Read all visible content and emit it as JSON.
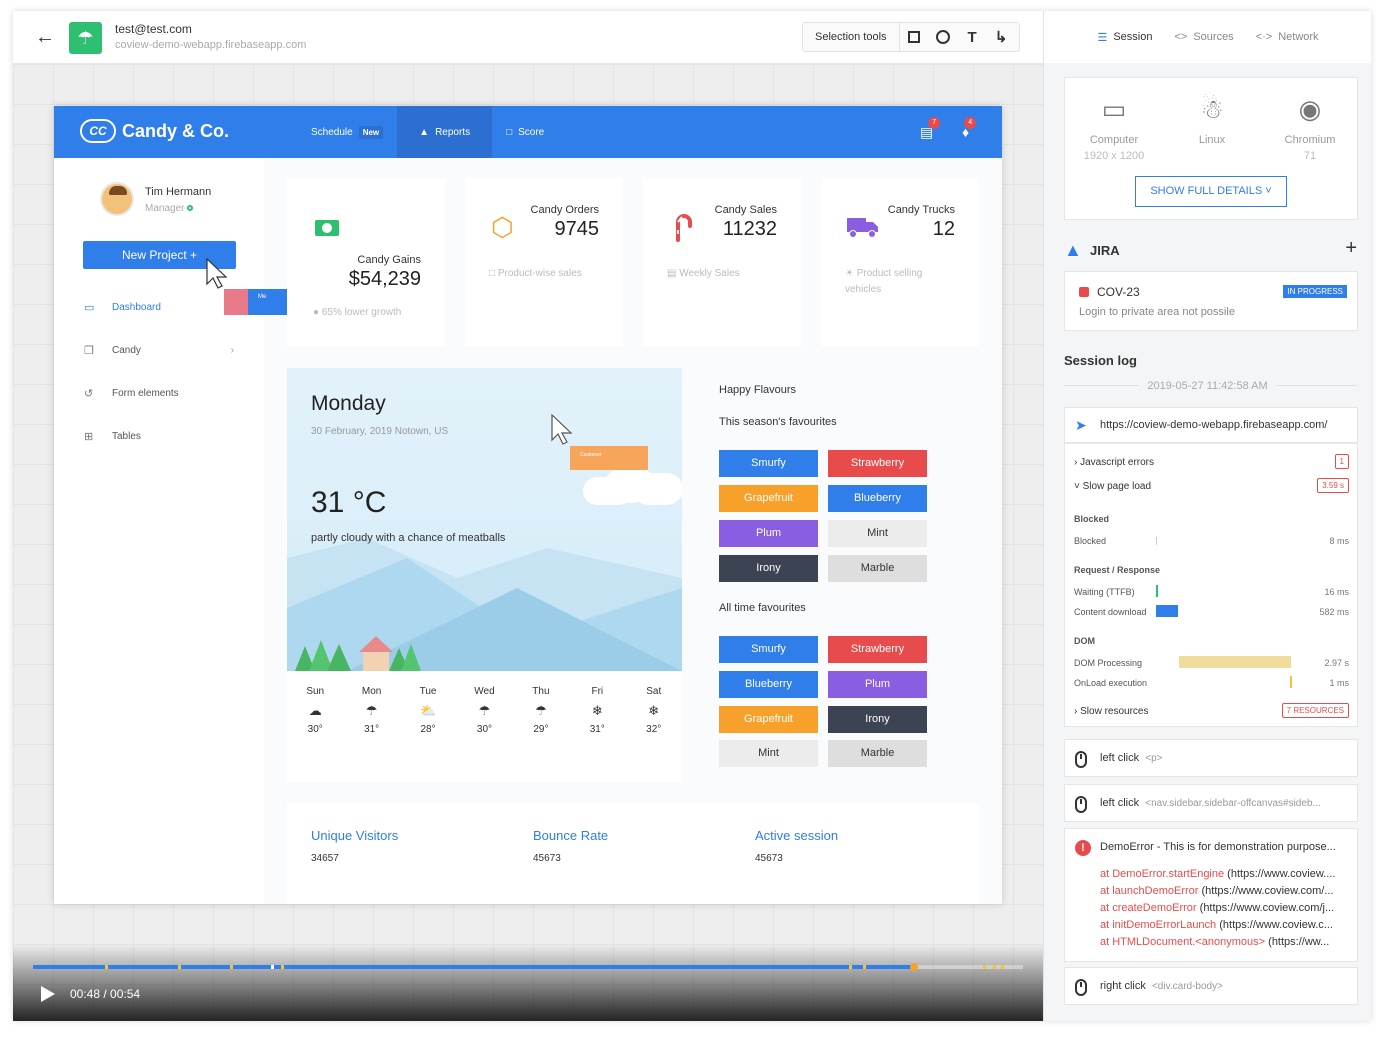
{
  "topbar": {
    "user_email": "test@test.com",
    "user_url": "coview-demo-webapp.firebaseapp.com",
    "selection_tools_label": "Selection tools"
  },
  "app": {
    "brand": "Candy & Co.",
    "brand_logo": "CC",
    "nav": [
      {
        "label": "Schedule",
        "badge": "New"
      },
      {
        "label": "Reports"
      },
      {
        "label": "Score"
      }
    ],
    "doc_badge": "7",
    "bell_badge": "4",
    "user_name": "Tim Hermann",
    "user_role": "Manager",
    "new_project": "New Project  +",
    "sidebar": [
      {
        "label": "Dashboard"
      },
      {
        "label": "Candy"
      },
      {
        "label": "Form elements"
      },
      {
        "label": "Tables"
      }
    ],
    "ghost_label": "Me",
    "cards": [
      {
        "title": "Candy Gains",
        "value": "$54,239",
        "foot": "65% lower growth"
      },
      {
        "title": "Candy Orders",
        "value": "9745",
        "foot": "Product-wise sales"
      },
      {
        "title": "Candy Sales",
        "value": "11232",
        "foot": "Weekly Sales"
      },
      {
        "title": "Candy Trucks",
        "value": "12",
        "foot": "Product selling vehicles"
      }
    ],
    "weather": {
      "day": "Monday",
      "date": "30 February, 2019 Notown, US",
      "temp": "31 °C",
      "desc": "partly cloudy with a chance of meatballs",
      "ghost_label": "Customer",
      "forecast": [
        {
          "day": "Sun",
          "temp": "30°"
        },
        {
          "day": "Mon",
          "temp": "31°"
        },
        {
          "day": "Tue",
          "temp": "28°"
        },
        {
          "day": "Wed",
          "temp": "30°"
        },
        {
          "day": "Thu",
          "temp": "29°"
        },
        {
          "day": "Fri",
          "temp": "31°"
        },
        {
          "day": "Sat",
          "temp": "32°"
        }
      ]
    },
    "flavours": {
      "title": "Happy Flavours",
      "season_title": "This season's favourites",
      "season": [
        "Smurfy",
        "Strawberry",
        "Grapefruit",
        "Blueberry",
        "Plum",
        "Mint",
        "Irony",
        "Marble"
      ],
      "alltime_title": "All time favourites",
      "alltime": [
        "Smurfy",
        "Strawberry",
        "Blueberry",
        "Plum",
        "Grapefruit",
        "Irony",
        "Mint",
        "Marble"
      ]
    },
    "metrics": [
      {
        "label": "Unique Visitors",
        "value": "34657"
      },
      {
        "label": "Bounce Rate",
        "value": "45673"
      },
      {
        "label": "Active session",
        "value": "45673"
      }
    ]
  },
  "player": {
    "time": "00:48 / 00:54",
    "progress_fraction": 0.89
  },
  "rpanel": {
    "tabs": [
      "Session",
      "Sources",
      "Network"
    ],
    "env": [
      {
        "name": "Computer",
        "value": "1920 x 1200",
        "icon": "monitor-icon"
      },
      {
        "name": "Linux",
        "value": "",
        "icon": "linux-icon"
      },
      {
        "name": "Chromium",
        "value": "71",
        "icon": "chromium-icon"
      }
    ],
    "show_details": "SHOW FULL DETAILS  ˅",
    "jira_title": "JIRA",
    "issue_key": "COV-23",
    "issue_status": "IN PROGRESS",
    "issue_desc": "Login to private area not possile",
    "session_log_title": "Session log",
    "session_timestamp": "2019-05-27 11:42:58 AM",
    "nav_url": "https://coview-demo-webapp.firebaseapp.com/",
    "js_errors_label": "Javascript errors",
    "js_errors_count": "1",
    "slow_load_label": "Slow page load",
    "slow_load_value": "3.59 s",
    "blocked_header": "Blocked",
    "blocked_label": "Blocked",
    "blocked_value": "8 ms",
    "reqres_header": "Request / Response",
    "ttfb_label": "Waiting (TTFB)",
    "ttfb_value": "16 ms",
    "download_label": "Content download",
    "download_value": "582 ms",
    "dom_header": "DOM",
    "domproc_label": "DOM Processing",
    "domproc_value": "2.97 s",
    "onload_label": "OnLoad execution",
    "onload_value": "1 ms",
    "slow_res_label": "Slow resources",
    "slow_res_value": "7 RESOURCES",
    "click1": {
      "action": "left click",
      "target": "<p>"
    },
    "click2": {
      "action": "left click",
      "target": "<nav.sidebar.sidebar-offcanvas#sideb..."
    },
    "error_title": "DemoError - This is for demonstration purpose...",
    "stack": [
      {
        "fn": "at DemoError.startEngine",
        "src": " (https://www.coview...."
      },
      {
        "fn": "at launchDemoError",
        "src": " (https://www.coview.com/..."
      },
      {
        "fn": "at createDemoError",
        "src": " (https://www.coview.com/j..."
      },
      {
        "fn": "at initDemoErrorLaunch",
        "src": " (https://www.coview.c..."
      },
      {
        "fn": "at HTMLDocument.<anonymous>",
        "src": " (https://ww..."
      }
    ],
    "click3": {
      "action": "right click",
      "target": "<div.card-body>"
    }
  },
  "colors": {
    "primary": "#2f7ee9",
    "red": "#e84b4b",
    "orange": "#f7a12b",
    "purple": "#8a5ee0",
    "dark": "#3c4352",
    "light": "#ececec"
  }
}
